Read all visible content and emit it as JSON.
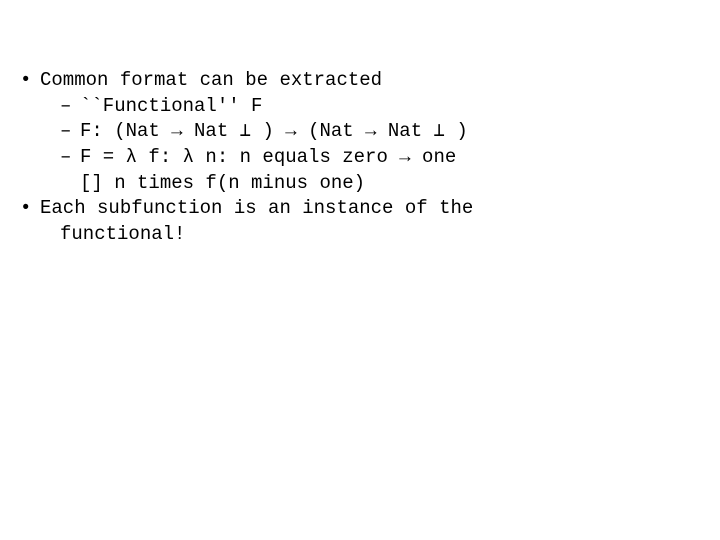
{
  "bullets": [
    {
      "text": "Common format can be extracted",
      "subs": [
        {
          "text": "``Functional'' F"
        },
        {
          "text": "F: (Nat → Nat ⊥ ) → (Nat → Nat ⊥ )"
        },
        {
          "text": "F = λ f: λ n: n equals zero → one",
          "cont": "[] n times f(n minus one)"
        }
      ]
    },
    {
      "text": "Each subfunction is an instance of the",
      "wrap": "functional!"
    }
  ]
}
